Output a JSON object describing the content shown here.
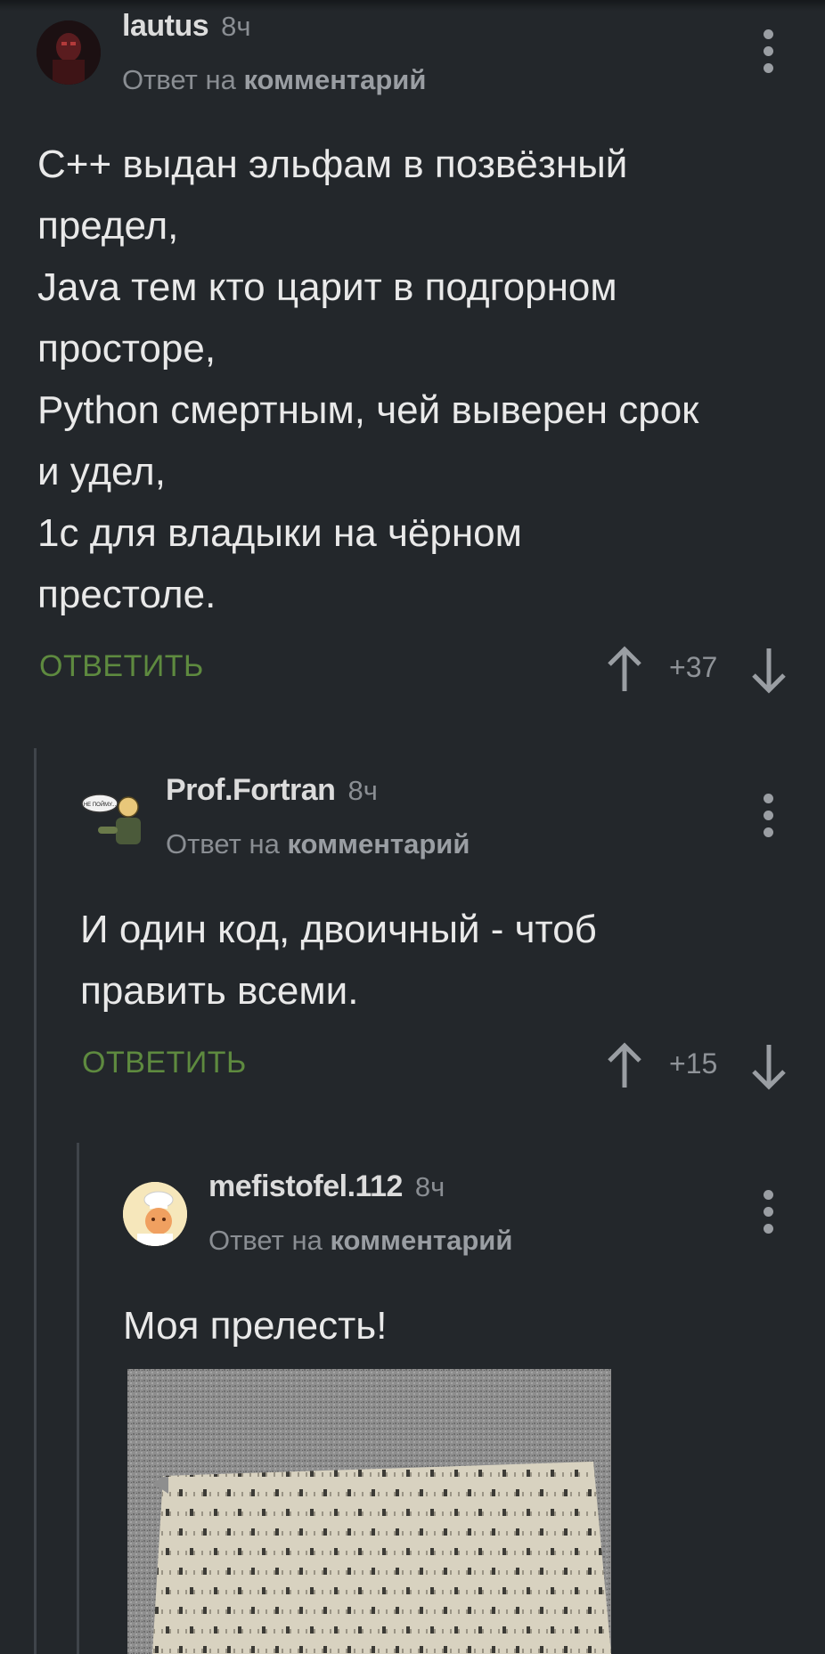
{
  "comments": [
    {
      "author": "lautus",
      "time": "8ч",
      "reply_prefix": "Ответ на",
      "reply_target": "комментарий",
      "lines": [
        "С++ выдан эльфам в позвёзный",
        "предел,",
        "Java тем кто царит в подгорном",
        "просторе,",
        "Python смертным, чей выверен срок",
        "и удел,",
        "1с для владыки на чёрном",
        "престоле."
      ],
      "reply_label": "ОТВЕТИТЬ",
      "score": "+37"
    },
    {
      "author": "Prof.Fortran",
      "time": "8ч",
      "reply_prefix": "Ответ на",
      "reply_target": "комментарий",
      "lines": [
        "И один код, двоичный - чтоб",
        "править всеми."
      ],
      "avatar_caption": "НЕ ПОЙМУ...",
      "reply_label": "ОТВЕТИТЬ",
      "score": "+15"
    },
    {
      "author": "mefistofel.112",
      "time": "8ч",
      "reply_prefix": "Ответ на",
      "reply_target": "комментарий",
      "lines": [
        "Моя прелесть!"
      ]
    }
  ],
  "colors": {
    "background": "#23272b",
    "reply_green": "#5e8a3f",
    "muted_text": "#8a8e93"
  },
  "icons": [
    "kebab-menu-icon",
    "upvote-arrow-icon",
    "downvote-arrow-icon"
  ]
}
